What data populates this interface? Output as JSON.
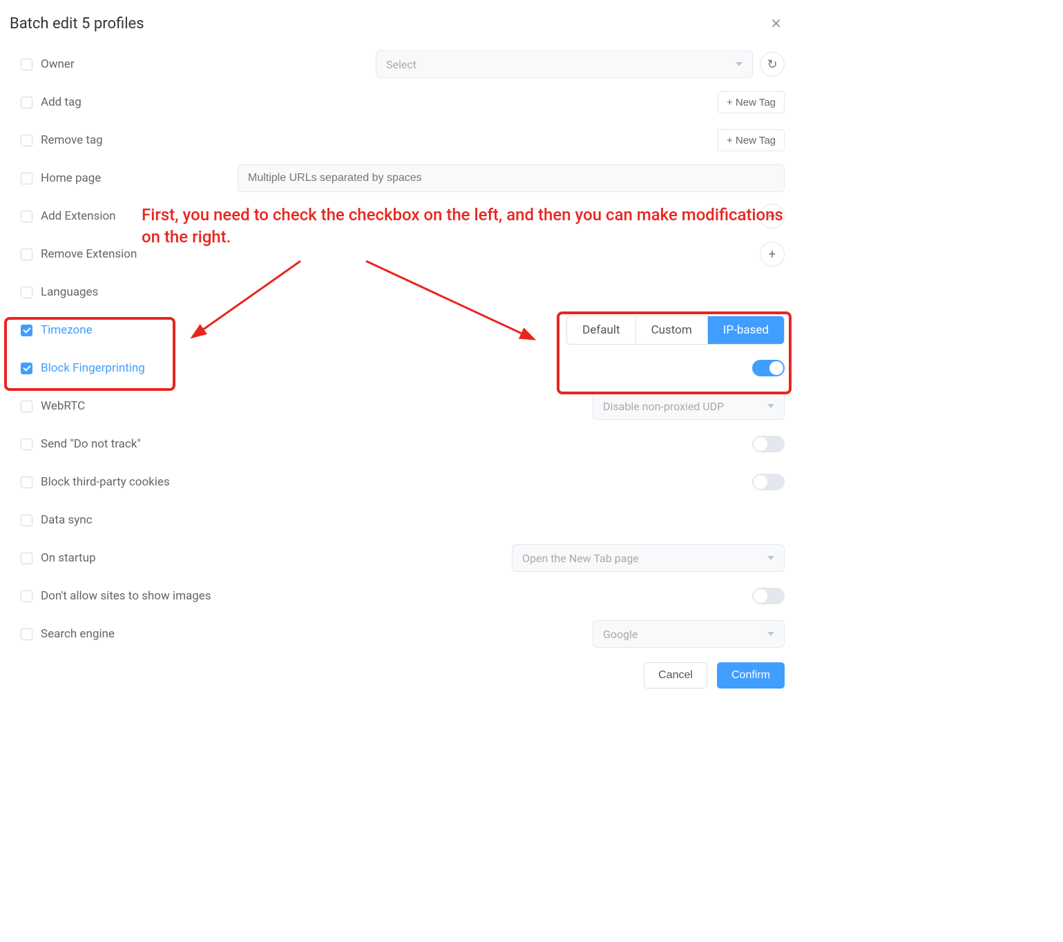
{
  "title": "Batch edit 5 profiles",
  "annotation": "First, you need to check the checkbox on the left, and then you can make modifications on the right.",
  "rows": {
    "owner": {
      "label": "Owner",
      "select_placeholder": "Select"
    },
    "add_tag": {
      "label": "Add tag",
      "btn": "+ New Tag"
    },
    "remove_tag": {
      "label": "Remove tag",
      "btn": "+ New Tag"
    },
    "home_page": {
      "label": "Home page",
      "placeholder": "Multiple URLs separated by spaces"
    },
    "add_ext": {
      "label": "Add Extension"
    },
    "remove_ext": {
      "label": "Remove Extension"
    },
    "languages": {
      "label": "Languages"
    },
    "timezone": {
      "label": "Timezone",
      "options": [
        "Default",
        "Custom",
        "IP-based"
      ],
      "selected": "IP-based"
    },
    "block_fp": {
      "label": "Block Fingerprinting"
    },
    "webrtc": {
      "label": "WebRTC",
      "value": "Disable non-proxied UDP"
    },
    "dnt": {
      "label": "Send \"Do not track\""
    },
    "block_3p": {
      "label": "Block third-party cookies"
    },
    "data_sync": {
      "label": "Data sync"
    },
    "startup": {
      "label": "On startup",
      "value": "Open the New Tab page"
    },
    "no_images": {
      "label": "Don't allow sites to show images"
    },
    "search": {
      "label": "Search engine",
      "value": "Google"
    }
  },
  "footer": {
    "cancel": "Cancel",
    "confirm": "Confirm"
  }
}
